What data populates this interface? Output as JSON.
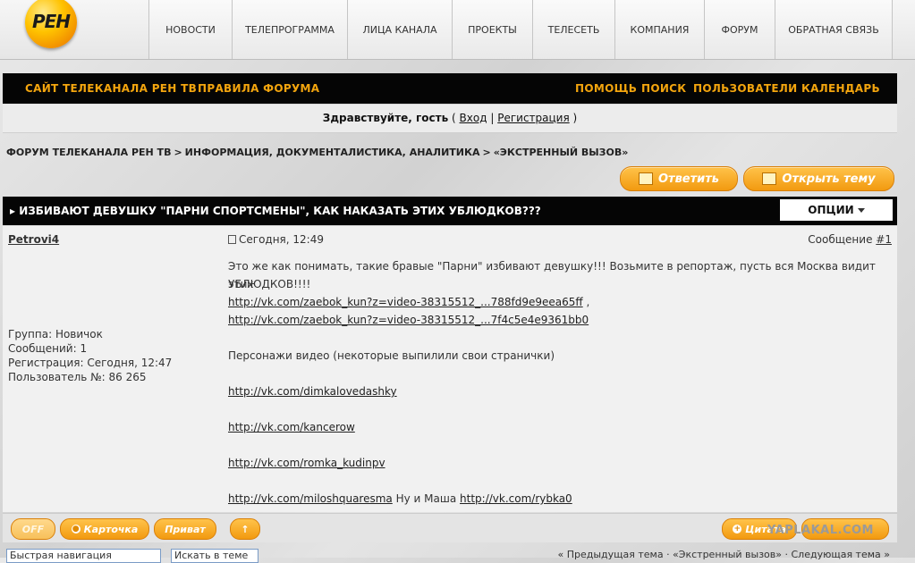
{
  "nav": {
    "logo_text": "РЕН",
    "items": [
      "НОВОСТИ",
      "ТЕЛЕПРОГРАММА",
      "ЛИЦА КАНАЛА",
      "ПРОЕКТЫ",
      "ТЕЛЕСЕТЬ",
      "КОМПАНИЯ",
      "ФОРУМ",
      "ОБРАТНАЯ СВЯЗЬ"
    ]
  },
  "bar": {
    "left": [
      "САЙТ ТЕЛЕКАНАЛА РЕН ТВ",
      "ПРАВИЛА ФОРУМА"
    ],
    "right": [
      "ПОМОЩЬ",
      "ПОИСК",
      "ПОЛЬЗОВАТЕЛИ",
      "КАЛЕНДАРЬ"
    ]
  },
  "greeting": {
    "text": "Здравствуйте, гость",
    "open": "(",
    "login": "Вход",
    "divider": "|",
    "register": "Регистрация",
    "close": ")"
  },
  "breadcrumb": [
    "ФОРУМ ТЕЛЕКАНАЛА РЕН ТВ",
    "ИНФОРМАЦИЯ, ДОКУМЕНТАЛИСТИКА, АНАЛИТИКА",
    "«ЭКСТРЕННЫЙ ВЫЗОВ»"
  ],
  "breadcrumb_sep": ">",
  "actions": {
    "reply": "Ответить",
    "new_topic": "Открыть тему"
  },
  "topic": {
    "title": "ИЗБИВАЮТ ДЕВУШКУ \"ПАРНИ СПОРТСМЕНЫ\", КАК НАКАЗАТЬ ЭТИХ УБЛЮДКОВ???",
    "options": "ОПЦИИ"
  },
  "post": {
    "author": "Petrovi4",
    "group": "Группа: Новичок",
    "posts": "Сообщений: 1",
    "registered": "Регистрация: Сегодня, 12:47",
    "user_no": "Пользователь №: 86 265",
    "date": "Сегодня, 12:49",
    "msg_label": "Сообщение",
    "msg_num": "#1",
    "line1": "Это же как понимать, такие бравые \"Парни\" избивают девушку!!! Возьмите в репортаж, пусть вся Москва видит этих",
    "line2": "УБЛЮДКОВ!!!!",
    "link1": "http://vk.com/zaebok_kun?z=video-38315512_...788fd9e9eea65ff",
    "link1_suffix": " ,",
    "link2": "http://vk.com/zaebok_kun?z=video-38315512_...7f4c5e4e9361bb0",
    "line3": "Персонажи видео (некоторые выпилили свои странички)",
    "link3": "http://vk.com/dimkalovedashky",
    "link4": "http://vk.com/kancerow",
    "link5": "http://vk.com/romka_kudinpv",
    "link6": "http://vk.com/miloshquaresma",
    "link6_mid": " Ну и Маша ",
    "link7": "http://vk.com/rybka0"
  },
  "postbar": {
    "off": "OFF",
    "card": "Карточка",
    "private": "Приват",
    "up": "↑",
    "quote": "Цитата"
  },
  "watermark": "YAPLAKAL.COM",
  "bottom": {
    "field1": "Быстрая навигация",
    "field2": "Искать в теме",
    "prevnext": "« Предыдущая тема · «Экстренный вызов» · Следующая тема »"
  }
}
